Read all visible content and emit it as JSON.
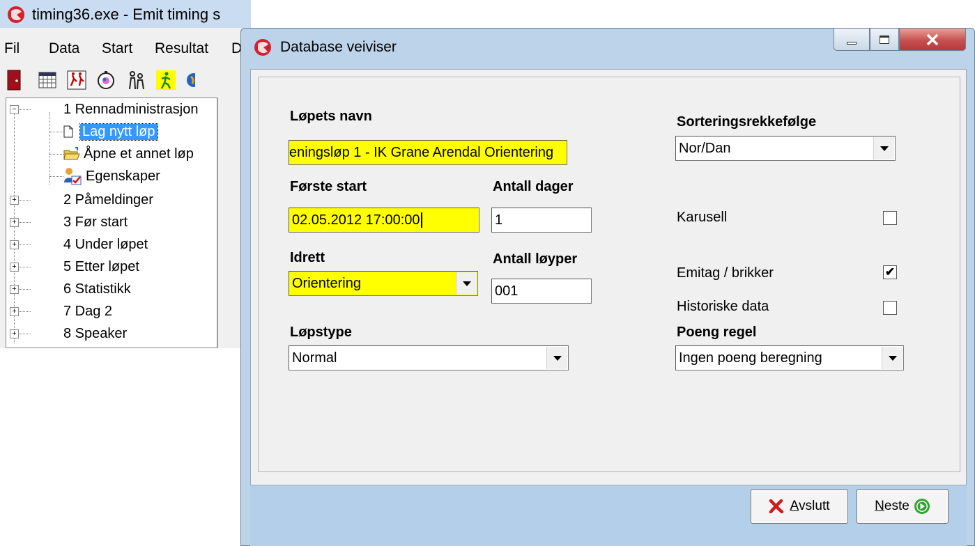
{
  "main_window": {
    "title": "timing36.exe - Emit timing s",
    "menu": [
      "Fil",
      "Data",
      "Start",
      "Resultat",
      "D"
    ],
    "toolbar_icons": [
      "door-icon",
      "calendar-grid-icon",
      "runners-icon",
      "stopwatch-icon",
      "people-icon",
      "runner-icon",
      "globe-icon"
    ],
    "tree": {
      "root_label": "1 Rennadministrasjon",
      "children": [
        {
          "label": "Lag nytt løp",
          "icon": "new-document-icon",
          "selected": true
        },
        {
          "label": "Åpne et annet løp",
          "icon": "open-folder-icon"
        },
        {
          "label": "Egenskaper",
          "icon": "user-properties-icon"
        }
      ],
      "groups": [
        "2 Påmeldinger",
        "3 Før start",
        "4 Under løpet",
        "5 Etter løpet",
        "6 Statistikk",
        "7 Dag 2",
        "8 Speaker"
      ]
    }
  },
  "dialog": {
    "title": "Database veiviser",
    "fields": {
      "lopets_navn": {
        "label": "Løpets navn",
        "value": "eningsløp 1 - IK Grane Arendal Orientering"
      },
      "forste_start": {
        "label": "Første start",
        "value": "02.05.2012 17:00:00"
      },
      "antall_dager": {
        "label": "Antall dager",
        "value": "1"
      },
      "idrett": {
        "label": "Idrett",
        "value": "Orientering"
      },
      "antall_loyper": {
        "label": "Antall løyper",
        "value": "001"
      },
      "lopstype": {
        "label": "Løpstype",
        "value": "Normal"
      },
      "sortering": {
        "label": "Sorteringsrekkefølge",
        "value": "Nor/Dan"
      },
      "poeng_regel": {
        "label": "Poeng regel",
        "value": "Ingen poeng beregning"
      }
    },
    "checkboxes": {
      "karusell": {
        "label": "Karusell",
        "checked": false,
        "mark": ""
      },
      "emitag": {
        "label": "Emitag / brikker",
        "checked": true,
        "mark": "✔"
      },
      "historiske": {
        "label": "Historiske data",
        "checked": false,
        "mark": ""
      }
    },
    "buttons": {
      "avslutt_mnemonic": "A",
      "avslutt_rest": "vslutt",
      "neste_mnemonic": "N",
      "neste_rest": "este"
    }
  },
  "colors": {
    "required_field": "#ffff00",
    "selection": "#3399ff",
    "dialog_frame": "#bcd3ea",
    "footer": "#b4cfea",
    "close_button": "#c75050"
  }
}
